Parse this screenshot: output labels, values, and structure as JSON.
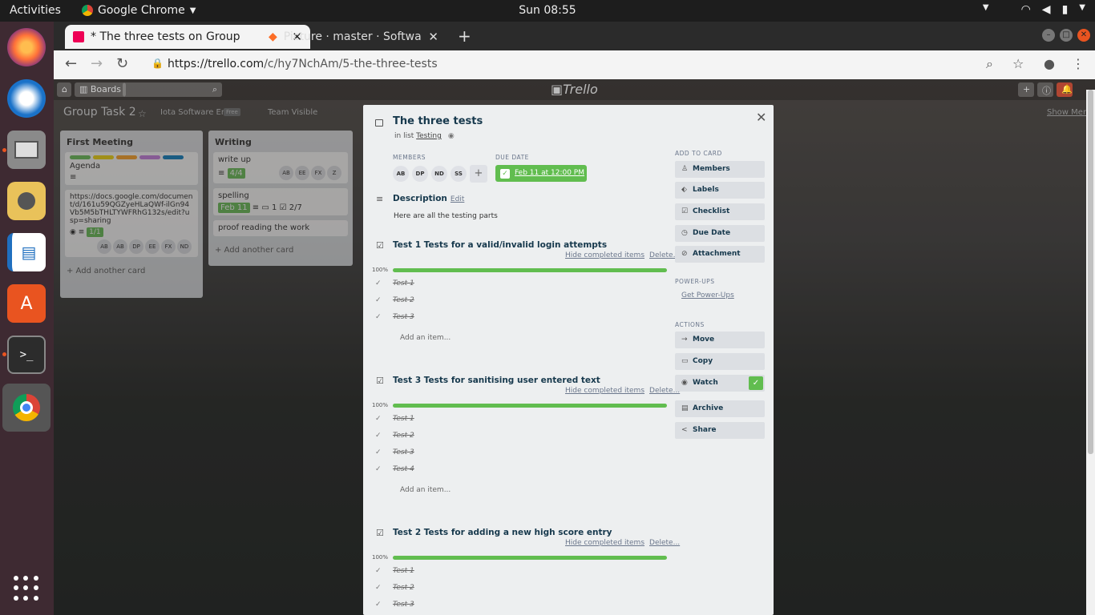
{
  "topbar": {
    "activities": "Activities",
    "app": "Google Chrome",
    "clock": "Sun 08:55"
  },
  "browser": {
    "tabs": [
      {
        "title": "* The three tests on Group",
        "active": true
      },
      {
        "title": "Picture · master · Softwar",
        "active": false
      }
    ],
    "url_domain": "https://trello.com",
    "url_path": "/c/hy7NchAm/5-the-three-tests"
  },
  "board": {
    "boards_button": "Boards",
    "title": "Group Task 2",
    "org": "Iota Software Eng",
    "org_badge": "Free",
    "visibility": "Team Visible",
    "show_menu": "Show Menu",
    "lists": [
      {
        "title": "First Meeting",
        "cards": [
          {
            "text": "Agenda"
          },
          {
            "text": "https://docs.google.com/document/d/161u59QGZyeHLaQWf-ilGn94Vb5M5bTHLTYWFRhG132s/edit?usp=sharing",
            "badge": "1/1",
            "members": [
              "AB",
              "AB",
              "DP",
              "EE",
              "FX",
              "ND"
            ]
          }
        ],
        "add": "+ Add another card"
      },
      {
        "title": "Writing",
        "cards": [
          {
            "text": "write up",
            "badge": "4/4",
            "members": [
              "AB",
              "EE",
              "FX",
              "Z"
            ]
          },
          {
            "text": "spelling",
            "due": "Feb 11",
            "comments": "1",
            "checklist": "2/7"
          },
          {
            "text": "proof reading the work"
          }
        ],
        "add": "+ Add another card"
      }
    ]
  },
  "card": {
    "title": "The three tests",
    "in_list_prefix": "in list",
    "list_name": "Testing",
    "members_label": "MEMBERS",
    "members": [
      "AB",
      "DP",
      "ND",
      "SS"
    ],
    "due_label": "DUE DATE",
    "due_date": "Feb 11 at 12:00 PM",
    "description_title": "Description",
    "edit_label": "Edit",
    "description": "Here are all the testing parts",
    "hide_completed": "Hide completed items",
    "delete_label": "Delete...",
    "add_item": "Add an item...",
    "checklists": [
      {
        "title": "Test 1 Tests for a valid/invalid login attempts",
        "progress": "100%",
        "items": [
          "Test 1",
          "Test 2",
          "Test 3"
        ]
      },
      {
        "title": "Test 3 Tests for sanitising user entered text",
        "progress": "100%",
        "items": [
          "Test 1",
          "Test 2",
          "Test 3",
          "Test 4"
        ]
      },
      {
        "title": "Test 2 Tests for adding a new high score entry",
        "progress": "100%",
        "items": [
          "Test 1",
          "Test 2",
          "Test 3"
        ]
      }
    ]
  },
  "sidebar": {
    "add_to_card": "ADD TO CARD",
    "add_buttons": [
      "Members",
      "Labels",
      "Checklist",
      "Due Date",
      "Attachment"
    ],
    "powerups_label": "POWER-UPS",
    "get_powerups": "Get Power-Ups",
    "actions_label": "ACTIONS",
    "action_buttons": [
      "Move",
      "Copy",
      "Watch",
      "Archive",
      "Share"
    ]
  },
  "colors": {
    "accent_green": "#61bd4f",
    "title_blue": "#17394d",
    "dock": "#3e2a32"
  }
}
